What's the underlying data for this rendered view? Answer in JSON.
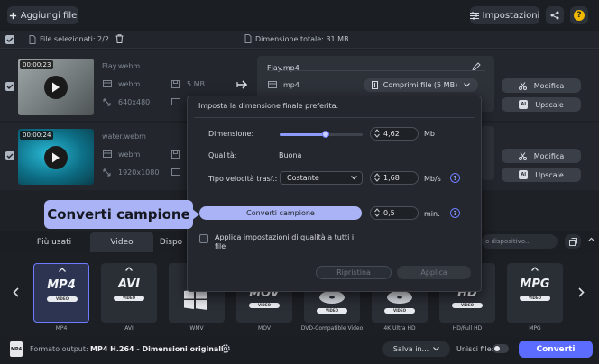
{
  "toolbar": {
    "add_files_label": "Aggiungi file",
    "settings_label": "Impostazioni",
    "help_label": "?"
  },
  "selection": {
    "files_selected": "File selezionati: 2/2",
    "total_size": "Dimensione totale: 31 MB"
  },
  "files": [
    {
      "name": "Flay.webm",
      "duration": "00:00:23",
      "format": "webm",
      "size": "5 MB",
      "resolution": "640x480"
    },
    {
      "name": "water.webm",
      "duration": "00:00:24",
      "format": "webm",
      "size": "",
      "resolution": "1920x1080"
    }
  ],
  "output": {
    "file_name": "Flay.mp4",
    "format": "mp4",
    "compress_label": "Comprimi file (5 MB)",
    "edit_label": "Modifica",
    "upscale_label": "Upscale"
  },
  "popup": {
    "title": "Imposta la dimensione finale preferita:",
    "size_label": "Dimensione:",
    "size_value": "4,62",
    "size_unit": "Mb",
    "quality_label": "Qualità:",
    "quality_value": "Buona",
    "bitrate_label": "Tipo velocità trasf.:",
    "bitrate_mode": "Costante",
    "bitrate_value": "1,68",
    "bitrate_unit": "Mb/s",
    "sample_button": "Converti campione",
    "sample_value": "0,5",
    "sample_unit": "min.",
    "apply_all_label": "Applica impostazioni di qualità a tutti i file",
    "reset_label": "Ripristina",
    "apply_label": "Applica",
    "slider_fraction": 0.55
  },
  "callout": "Converti campione",
  "tabs": [
    "Più usati",
    "Video",
    "Dispo"
  ],
  "search_placeholder": "o dispositivo...",
  "formats": [
    {
      "badge": "MP4",
      "name": "MP4"
    },
    {
      "badge": "AVI",
      "name": "AVI"
    },
    {
      "badge": "",
      "name": "WMV"
    },
    {
      "badge": "MOV",
      "name": "MOV"
    },
    {
      "badge": "",
      "name": "DVD-Compatible Video"
    },
    {
      "badge": "",
      "name": "4K Ultra HD"
    },
    {
      "badge": "HD",
      "name": "HD/Full HD"
    },
    {
      "badge": "MPG",
      "name": "MPG"
    }
  ],
  "bottom": {
    "output_label": "Formato output:",
    "output_value": "MP4 H.264 - Dimensioni originali",
    "save_label": "Salva in...",
    "merge_label": "Unisci file:",
    "convert_label": "Converti"
  },
  "colors": {
    "accent": "#5b6cff",
    "callout_bg": "#a9b3f5"
  }
}
